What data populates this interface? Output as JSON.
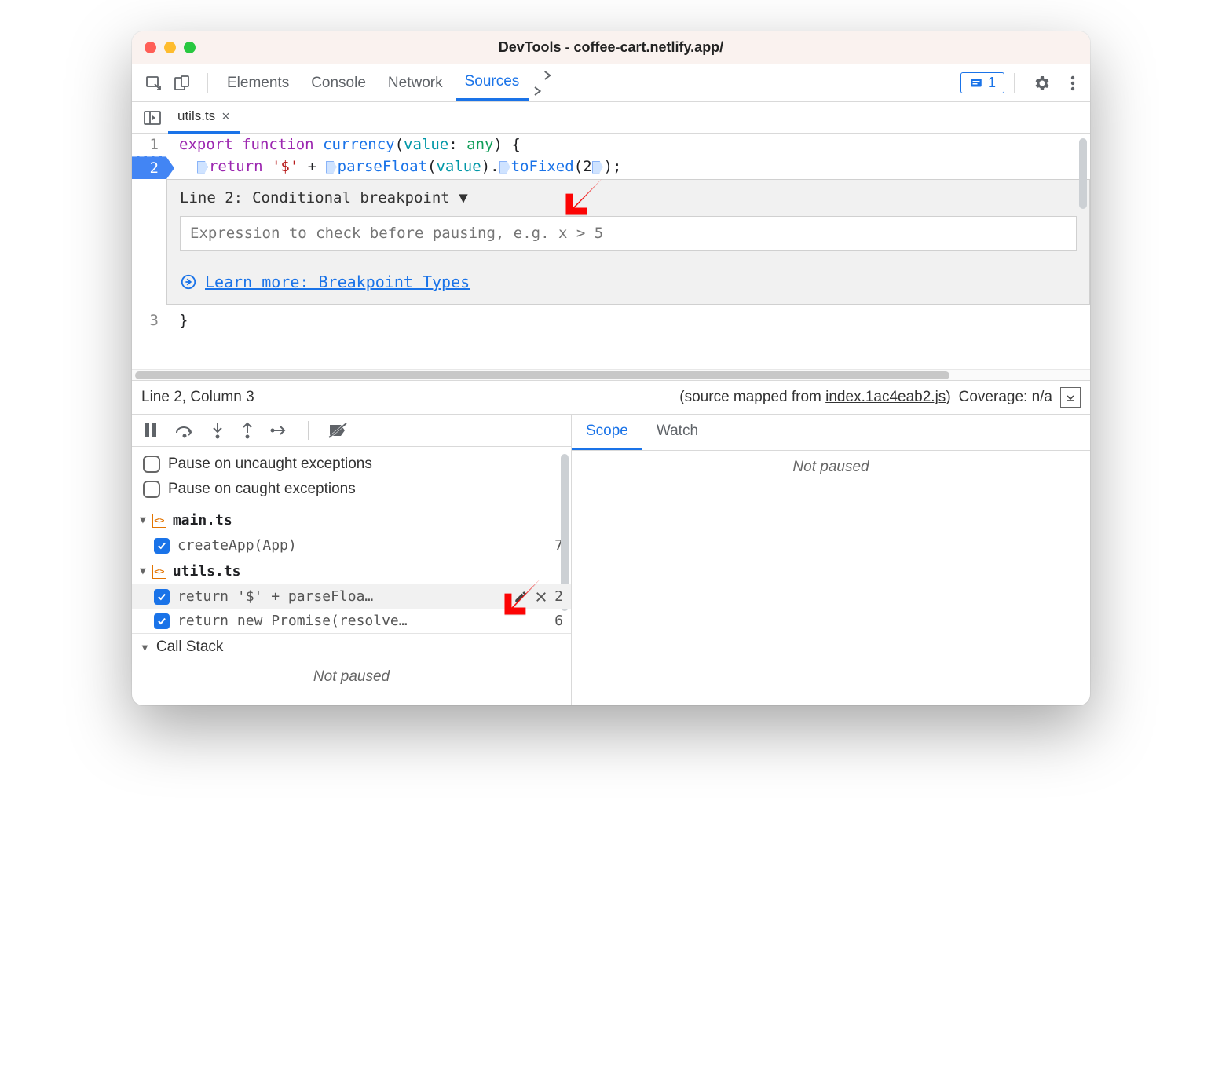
{
  "window": {
    "title": "DevTools - coffee-cart.netlify.app/"
  },
  "toolbar": {
    "tabs": {
      "elements": "Elements",
      "console": "Console",
      "network": "Network",
      "sources": "Sources"
    },
    "issues_count": "1"
  },
  "file_tabs": {
    "current": "utils.ts"
  },
  "code": {
    "line1_num": "1",
    "line2_num": "2",
    "line3_num": "3",
    "kw_export": "export",
    "kw_function": "function",
    "fn_name": "currency",
    "param": "value",
    "type_colon": ": ",
    "type_any": "any",
    "open": ") {",
    "kw_return": "return",
    "str_dollar": "'$'",
    "plus": " + ",
    "fn_parse": "parseFloat",
    "val": "value",
    "dot": ".",
    "fn_fixed": "toFixed",
    "two": "2",
    "semi": ");",
    "close": "}"
  },
  "cond_panel": {
    "line_label": "Line 2:",
    "type_label": "Conditional breakpoint",
    "placeholder": "Expression to check before pausing, e.g. x > 5",
    "learn_more": "Learn more: Breakpoint Types"
  },
  "status": {
    "pos": "Line 2, Column 3",
    "mapped_prefix": "(source mapped from ",
    "mapped_file": "index.1ac4eab2.js",
    "mapped_suffix": ")",
    "coverage": "Coverage: n/a"
  },
  "debugger": {
    "pause_uncaught": "Pause on uncaught exceptions",
    "pause_caught": "Pause on caught exceptions",
    "files": {
      "main": {
        "name": "main.ts",
        "bp1_text": "createApp(App)",
        "bp1_line": "7"
      },
      "utils": {
        "name": "utils.ts",
        "bp1_text": "return '$' + parseFloa…",
        "bp1_line": "2",
        "bp2_text": "return new Promise(resolve…",
        "bp2_line": "6"
      }
    },
    "callstack": "Call Stack",
    "not_paused": "Not paused"
  },
  "scope": {
    "scope_tab": "Scope",
    "watch_tab": "Watch",
    "not_paused": "Not paused"
  }
}
